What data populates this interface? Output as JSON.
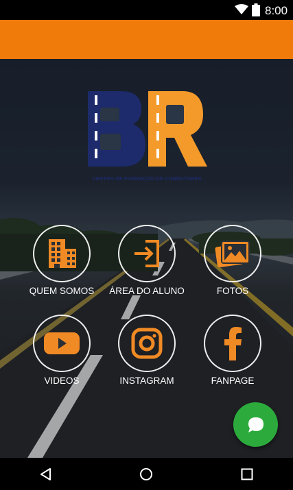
{
  "status_bar": {
    "time": "8:00"
  },
  "logo": {
    "text": "BR",
    "caption": "CENTRO DE FORMAÇÃO DE CONDUTORES"
  },
  "menu": [
    {
      "label": "QUEM SOMOS",
      "icon": "building-icon"
    },
    {
      "label": "ÁREA DO ALUNO",
      "icon": "sign-in-icon"
    },
    {
      "label": "FOTOS",
      "icon": "photos-icon"
    },
    {
      "label": "VIDEOS",
      "icon": "youtube-icon"
    },
    {
      "label": "INSTAGRAM",
      "icon": "instagram-icon"
    },
    {
      "label": "FANPAGE",
      "icon": "facebook-icon"
    }
  ],
  "fab": {
    "icon": "chat-bubble-icon"
  },
  "nav_bar": {
    "icons": [
      "back-icon",
      "home-icon",
      "recents-icon"
    ]
  },
  "colors": {
    "accent": "#f07a0a",
    "icon_orange": "#f08a24",
    "logo_navy": "#1d2a6b",
    "fab_green": "#2cab3c"
  }
}
